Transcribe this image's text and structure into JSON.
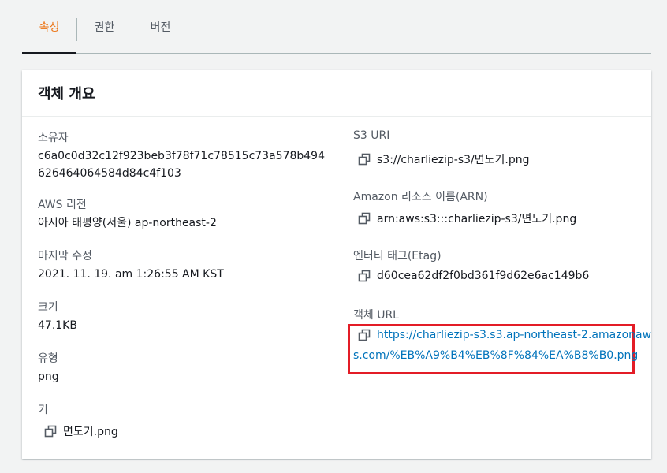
{
  "tabs": [
    {
      "label": "속성",
      "active": true
    },
    {
      "label": "권한",
      "active": false
    },
    {
      "label": "버전",
      "active": false
    }
  ],
  "card": {
    "title": "객체 개요",
    "left": {
      "owner_label": "소유자",
      "owner_value": "c6a0c0d32c12f923beb3f78f71c78515c73a578b494626464064584d84c4f103",
      "region_label": "AWS 리전",
      "region_value": "아시아 태평양(서울) ap-northeast-2",
      "modified_label": "마지막 수정",
      "modified_value": "2021. 11. 19. am 1:26:55 AM KST",
      "size_label": "크기",
      "size_value": "47.1KB",
      "type_label": "유형",
      "type_value": "png",
      "key_label": "키",
      "key_value": "면도기.png"
    },
    "right": {
      "s3uri_label": "S3 URI",
      "s3uri_value": "s3://charliezip-s3/면도기.png",
      "arn_label": "Amazon 리소스 이름(ARN)",
      "arn_value": "arn:aws:s3:::charliezip-s3/면도기.png",
      "etag_label": "엔터티 태그(Etag)",
      "etag_value": "d60cea62df2f0bd361f9d62e6ac149b6",
      "url_label": "객체 URL",
      "url_value_line1": "https://charliezip-s3.s3.ap-northeast-2.amazonaw",
      "url_value_line2": "s.com/%EB%A9%B4%EB%8F%84%EA%B8%B0.png"
    }
  },
  "colors": {
    "active_tab": "#ec7211",
    "link": "#0073bb",
    "highlight_box": "#e31c26",
    "background": "#f2f3f3"
  },
  "icons": {
    "copy": "copy-icon"
  }
}
